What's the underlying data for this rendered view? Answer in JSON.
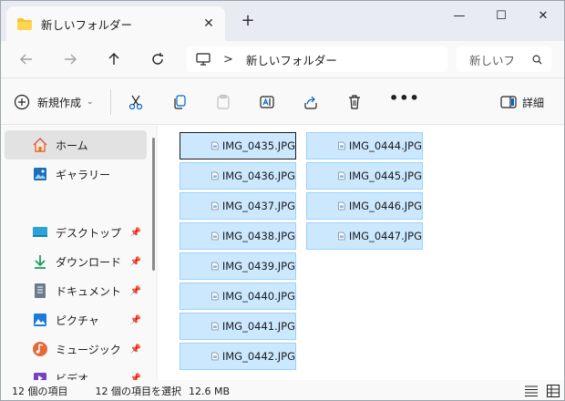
{
  "window": {
    "tab_title": "新しいフォルダー",
    "tab_close": "✕",
    "new_tab": "+",
    "minimize": "—",
    "maximize": "☐",
    "close": "✕"
  },
  "address": {
    "separator": ">",
    "crumb": "新しいフォルダー",
    "search_placeholder": "新しいフ"
  },
  "toolbar": {
    "new_label": "新規作成",
    "new_chevron": "⌄",
    "more": "•••",
    "details_label": "詳細"
  },
  "sidebar": {
    "items": [
      {
        "label": "ホーム",
        "icon": "home-icon",
        "selected": true
      },
      {
        "label": "ギャラリー",
        "icon": "gallery-icon"
      },
      {
        "label": "デスクトップ",
        "icon": "desktop-icon",
        "pinned": true
      },
      {
        "label": "ダウンロード",
        "icon": "download-icon",
        "pinned": true
      },
      {
        "label": "ドキュメント",
        "icon": "document-icon",
        "pinned": true
      },
      {
        "label": "ピクチャ",
        "icon": "pictures-icon",
        "pinned": true
      },
      {
        "label": "ミュージック",
        "icon": "music-icon",
        "pinned": true
      },
      {
        "label": "ビデオ",
        "icon": "video-icon",
        "pinned": true
      }
    ]
  },
  "files": [
    "IMG_0435.JPG",
    "IMG_0436.JPG",
    "IMG_0437.JPG",
    "IMG_0438.JPG",
    "IMG_0439.JPG",
    "IMG_0440.JPG",
    "IMG_0441.JPG",
    "IMG_0442.JPG",
    "IMG_0444.JPG",
    "IMG_0445.JPG",
    "IMG_0446.JPG",
    "IMG_0447.JPG"
  ],
  "status": {
    "item_count": "12 個の項目",
    "selected_count": "12 個の項目を選択",
    "selected_size": "12.6 MB"
  },
  "colors": {
    "selection_fill": "#cce8ff",
    "selection_border": "#99d1ff",
    "folder": "#f4c430",
    "accent": "#0067c0"
  }
}
